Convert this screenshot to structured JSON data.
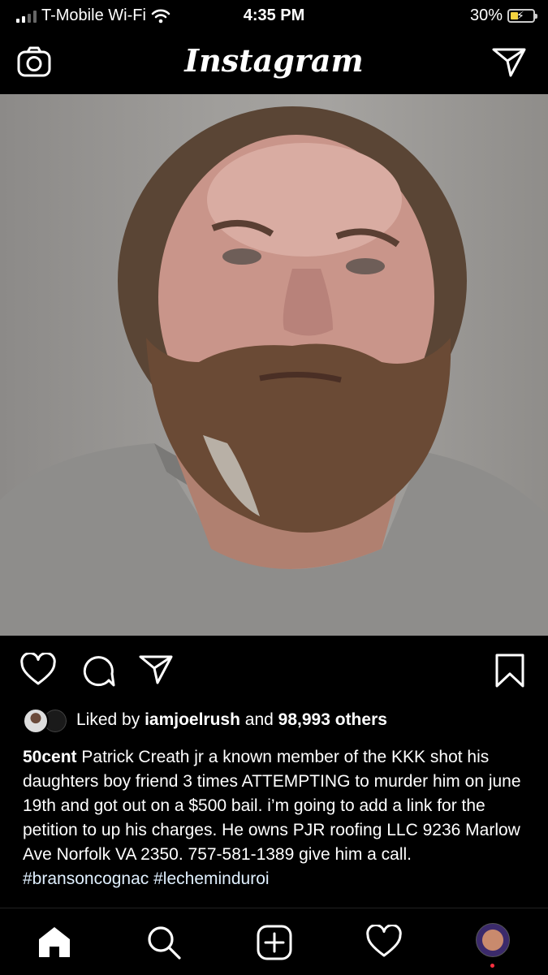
{
  "status_bar": {
    "carrier": "T-Mobile Wi-Fi",
    "time": "4:35 PM",
    "battery": "30%",
    "battery_level": 0.3
  },
  "header": {
    "title": "Instagram"
  },
  "post": {
    "liked_by_prefix": "Liked by",
    "liked_by_user": "iamjoelrush",
    "liked_by_connector": "and",
    "liked_by_count": "98,993 others",
    "author": "50cent",
    "caption": "Patrick Creath jr a known member of the KKK shot his daughters boy friend 3 times ATTEMPTING to murder him on june 19th and got out on a $500 bail. i’m going to add a link for the petition to up his charges. He owns PJR roofing LLC 9236 Marlow Ave Norfolk VA 2350. 757-581-1389 give him a call.",
    "hashtags": "#bransoncognac #lecheminduroi"
  },
  "icons": {
    "header": [
      "camera-icon",
      "direct-message-icon"
    ],
    "actions": [
      "heart-icon",
      "comment-icon",
      "share-icon",
      "bookmark-icon"
    ],
    "nav": [
      "home-icon",
      "search-icon",
      "add-post-icon",
      "activity-heart-icon",
      "profile-avatar"
    ]
  },
  "colors": {
    "background": "#000000",
    "text": "#ffffff",
    "battery_fill": "#f5d33f",
    "notification_dot": "#ff3040"
  }
}
